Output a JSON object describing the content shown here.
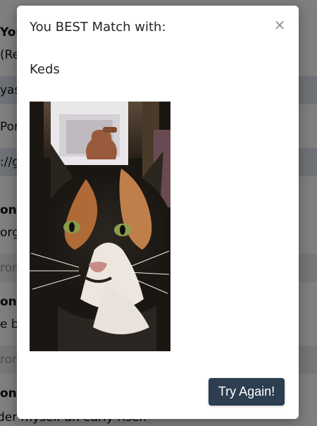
{
  "background": {
    "rows": [
      {
        "text": "You",
        "style": "bold"
      },
      {
        "text": "(Rec",
        "style": "plain"
      },
      {
        "text": "yas",
        "style": "band"
      },
      {
        "text": "Port",
        "style": "plain"
      },
      {
        "text": "://g",
        "style": "band"
      },
      {
        "text": "on",
        "style": "bold"
      },
      {
        "text": "org",
        "style": "plain"
      },
      {
        "text": "rong",
        "style": "grey"
      },
      {
        "text": "on",
        "style": "bold"
      },
      {
        "text": "e ba",
        "style": "plain"
      },
      {
        "text": "rong",
        "style": "grey"
      },
      {
        "text": "on",
        "style": "bold"
      },
      {
        "text": "der myself an early riser.",
        "style": "plain"
      }
    ]
  },
  "modal": {
    "title": "You BEST Match with:",
    "close_label": "×",
    "match_name": "Keds",
    "photo_icon": "cat-photo",
    "try_again_label": "Try Again!"
  },
  "colors": {
    "button_bg": "#2c3e50",
    "band": "#dde4ee",
    "backdrop": "rgba(0,0,0,0.5)"
  }
}
